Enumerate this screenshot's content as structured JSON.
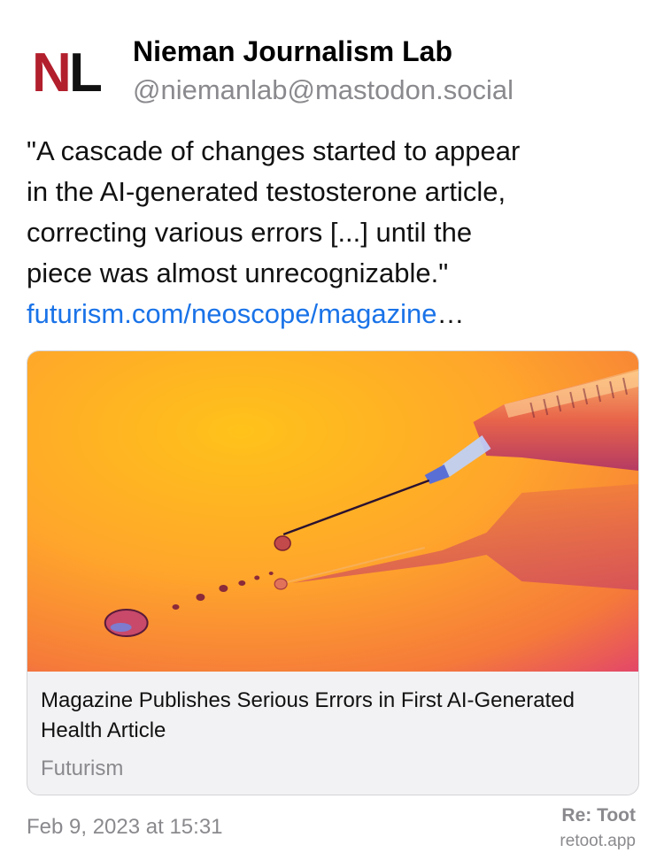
{
  "author": {
    "avatar_letters": {
      "first": "N",
      "second": "L"
    },
    "name": "Nieman Journalism Lab",
    "handle": "@niemanlab@mastodon.social"
  },
  "post": {
    "lines": [
      "\"A cascade of changes started to appear",
      "in the AI-generated testosterone article,",
      "correcting various errors [...] until the",
      "piece was almost unrecognizable.\""
    ],
    "link_text": "futurism.com/neoscope/magazine",
    "link_ellipsis": "…"
  },
  "card": {
    "title": "Magazine Publishes Serious Errors in First AI-Generated Health Article",
    "source": "Futurism",
    "image_description_icon": "syringe-image"
  },
  "footer": {
    "timestamp": "Feb 9, 2023 at 15:31",
    "brand": "Re: Toot",
    "brand_url": "retoot.app"
  },
  "colors": {
    "link": "#1a73e8",
    "muted": "#8a8a8e",
    "brand_red": "#b21f2d"
  }
}
